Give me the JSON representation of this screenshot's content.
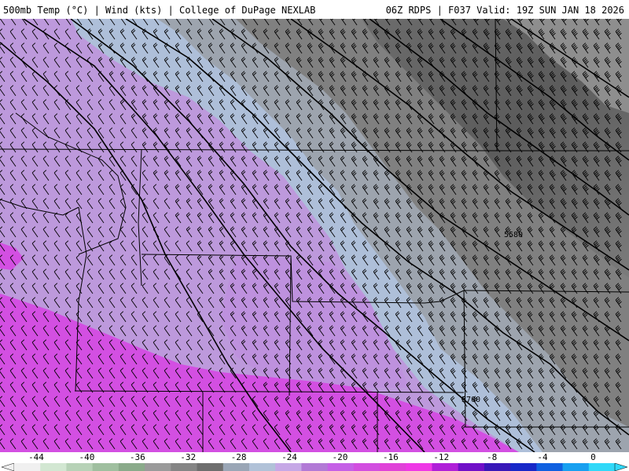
{
  "header": {
    "left_title": "500mb Temp (°C) | Wind (kts) | College of DuPage NEXLAB",
    "right_title": "06Z RDPS | F037 Valid: 19Z SUN JAN 18 2026"
  },
  "contour_labels": [
    "5580",
    "5700"
  ],
  "colorbar": {
    "ticks": [
      "-44",
      "-40",
      "-36",
      "-32",
      "-28",
      "-24",
      "-20",
      "-16",
      "-12",
      "-8",
      "-4",
      "0"
    ],
    "colors": [
      "#f0f0f0",
      "#d2e7d2",
      "#b7d2b7",
      "#9fbf9f",
      "#8aaa8a",
      "#9a9a9a",
      "#858585",
      "#6e6e6e",
      "#9aa6b6",
      "#b1c2d8",
      "#c6a8e6",
      "#b27ad6",
      "#c560e6",
      "#d24ee0",
      "#e042d8",
      "#ef38e6",
      "#b020d8",
      "#7010c8",
      "#3818b8",
      "#1828c8",
      "#1060e0",
      "#18a0f0",
      "#30d8f8"
    ]
  },
  "theme": {
    "purple_light": "#bfa0de",
    "purple_mid": "#b88ad8",
    "magenta": "#d84ee6",
    "lightblue": "#aebfd9",
    "gray_light": "#9aa3ae",
    "gray_mid": "#7d7d7d",
    "gray_dark": "#5d5d5d"
  }
}
